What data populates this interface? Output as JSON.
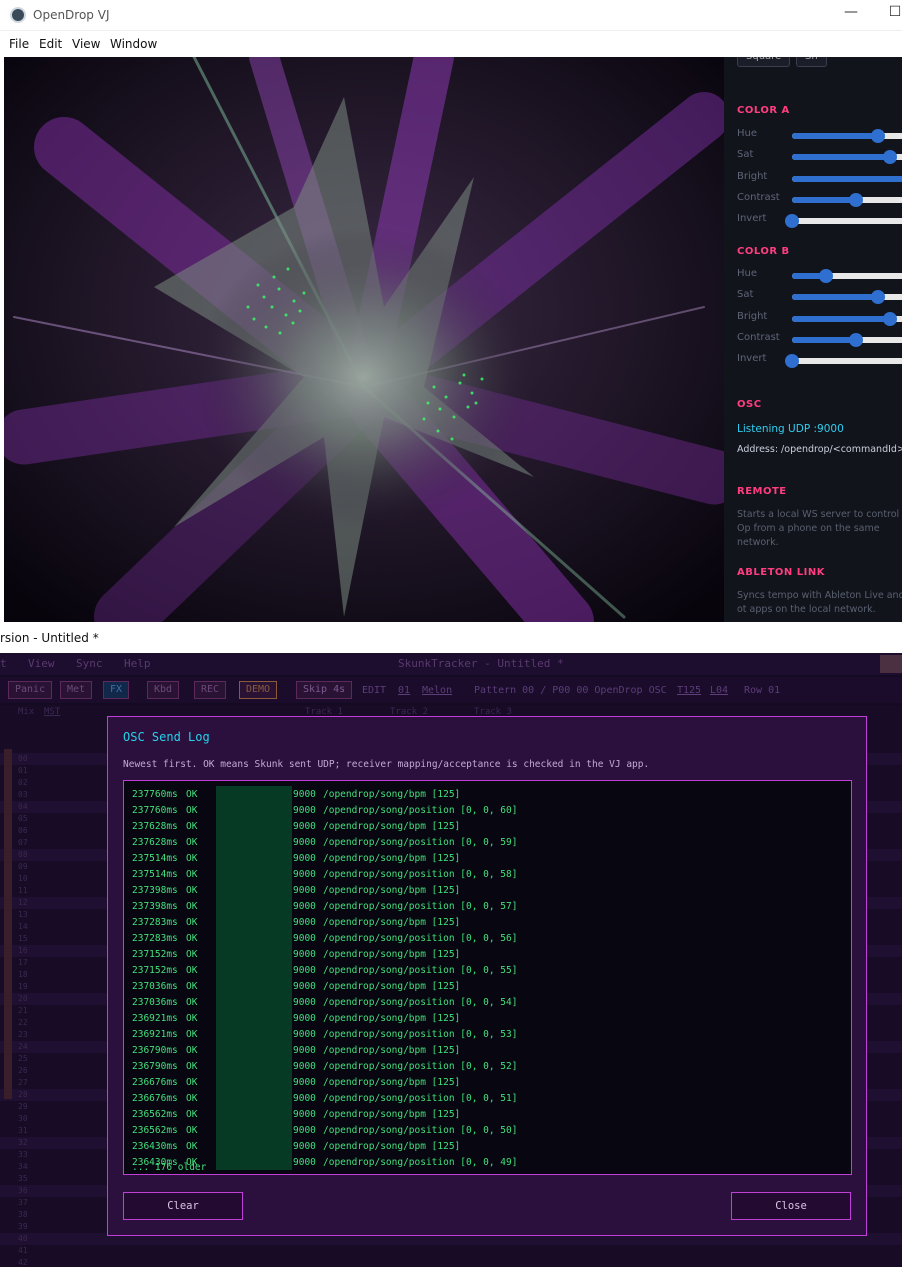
{
  "vj": {
    "title": "OpenDrop VJ",
    "menu": [
      "File",
      "Edit",
      "View",
      "Window"
    ],
    "window_controls": [
      "—",
      "☐"
    ],
    "panel": {
      "top_buttons": [
        "Square",
        "Sh"
      ],
      "color_a": {
        "title": "COLOR A",
        "sliders": [
          {
            "label": "Hue",
            "value": 0.72
          },
          {
            "label": "Sat",
            "value": 0.82
          },
          {
            "label": "Bright",
            "value": 1.0
          },
          {
            "label": "Contrast",
            "value": 0.53
          },
          {
            "label": "Invert",
            "value": 0.0
          }
        ]
      },
      "color_b": {
        "title": "COLOR B",
        "sliders": [
          {
            "label": "Hue",
            "value": 0.28
          },
          {
            "label": "Sat",
            "value": 0.72
          },
          {
            "label": "Bright",
            "value": 0.82
          },
          {
            "label": "Contrast",
            "value": 0.53
          },
          {
            "label": "Invert",
            "value": 0.0
          }
        ]
      },
      "osc": {
        "title": "OSC",
        "status": "Listening UDP :9000",
        "address": "Address: /opendrop/<commandId> f"
      },
      "remote": {
        "title": "REMOTE",
        "desc": "Starts a local WS server to control Op from a phone on the same network."
      },
      "ableton": {
        "title": "ABLETON LINK",
        "desc": "Syncs tempo with Ableton Live and ot apps on the local network."
      },
      "accent_color": "#ff3d7f",
      "slider_color": "#2f6fcf"
    }
  },
  "sk": {
    "window_title": "rsion - Untitled *",
    "menu": [
      "t",
      "View",
      "Sync",
      "Help"
    ],
    "app_title": "SkunkTracker - Untitled *",
    "toolbar": {
      "buttons": [
        "Panic",
        "Met",
        "FX",
        "Kbd",
        "REC",
        "DEMO",
        "Skip 4s"
      ],
      "edit_label": "EDIT",
      "octave": "01",
      "mode": "Melon",
      "pattern": "Pattern 00 / P00 00 OpenDrop OSC",
      "tempo": "T125",
      "loop": "L04",
      "row": "Row 01"
    },
    "mix_label": "Mix",
    "mst_label": "MST",
    "tracks": [
      "Track 1",
      "Track 2",
      "Track 3"
    ],
    "row_numbers": [
      "00",
      "01",
      "02",
      "03",
      "04",
      "05",
      "06",
      "07",
      "08",
      "09",
      "10",
      "11",
      "12",
      "13",
      "14",
      "15",
      "16",
      "17",
      "18",
      "19",
      "20",
      "21",
      "22",
      "23",
      "24",
      "25",
      "26",
      "27",
      "28",
      "29",
      "30",
      "31",
      "32",
      "33",
      "34",
      "35",
      "36",
      "37",
      "38",
      "39",
      "40",
      "41",
      "42",
      "43",
      "44",
      "45"
    ],
    "modal": {
      "title": "OSC Send Log",
      "hint": "Newest first. OK means Skunk sent UDP; receiver mapping/acceptance is checked in the VJ app.",
      "entries": [
        {
          "ms": "237760ms",
          "status": "OK",
          "port": "9000",
          "msg": "/opendrop/song/bpm [125]"
        },
        {
          "ms": "237760ms",
          "status": "OK",
          "port": "9000",
          "msg": "/opendrop/song/position [0, 0, 60]"
        },
        {
          "ms": "237628ms",
          "status": "OK",
          "port": "9000",
          "msg": "/opendrop/song/bpm [125]"
        },
        {
          "ms": "237628ms",
          "status": "OK",
          "port": "9000",
          "msg": "/opendrop/song/position [0, 0, 59]"
        },
        {
          "ms": "237514ms",
          "status": "OK",
          "port": "9000",
          "msg": "/opendrop/song/bpm [125]"
        },
        {
          "ms": "237514ms",
          "status": "OK",
          "port": "9000",
          "msg": "/opendrop/song/position [0, 0, 58]"
        },
        {
          "ms": "237398ms",
          "status": "OK",
          "port": "9000",
          "msg": "/opendrop/song/bpm [125]"
        },
        {
          "ms": "237398ms",
          "status": "OK",
          "port": "9000",
          "msg": "/opendrop/song/position [0, 0, 57]"
        },
        {
          "ms": "237283ms",
          "status": "OK",
          "port": "9000",
          "msg": "/opendrop/song/bpm [125]"
        },
        {
          "ms": "237283ms",
          "status": "OK",
          "port": "9000",
          "msg": "/opendrop/song/position [0, 0, 56]"
        },
        {
          "ms": "237152ms",
          "status": "OK",
          "port": "9000",
          "msg": "/opendrop/song/bpm [125]"
        },
        {
          "ms": "237152ms",
          "status": "OK",
          "port": "9000",
          "msg": "/opendrop/song/position [0, 0, 55]"
        },
        {
          "ms": "237036ms",
          "status": "OK",
          "port": "9000",
          "msg": "/opendrop/song/bpm [125]"
        },
        {
          "ms": "237036ms",
          "status": "OK",
          "port": "9000",
          "msg": "/opendrop/song/position [0, 0, 54]"
        },
        {
          "ms": "236921ms",
          "status": "OK",
          "port": "9000",
          "msg": "/opendrop/song/bpm [125]"
        },
        {
          "ms": "236921ms",
          "status": "OK",
          "port": "9000",
          "msg": "/opendrop/song/position [0, 0, 53]"
        },
        {
          "ms": "236790ms",
          "status": "OK",
          "port": "9000",
          "msg": "/opendrop/song/bpm [125]"
        },
        {
          "ms": "236790ms",
          "status": "OK",
          "port": "9000",
          "msg": "/opendrop/song/position [0, 0, 52]"
        },
        {
          "ms": "236676ms",
          "status": "OK",
          "port": "9000",
          "msg": "/opendrop/song/bpm [125]"
        },
        {
          "ms": "236676ms",
          "status": "OK",
          "port": "9000",
          "msg": "/opendrop/song/position [0, 0, 51]"
        },
        {
          "ms": "236562ms",
          "status": "OK",
          "port": "9000",
          "msg": "/opendrop/song/bpm [125]"
        },
        {
          "ms": "236562ms",
          "status": "OK",
          "port": "9000",
          "msg": "/opendrop/song/position [0, 0, 50]"
        },
        {
          "ms": "236430ms",
          "status": "OK",
          "port": "9000",
          "msg": "/opendrop/song/bpm [125]"
        },
        {
          "ms": "236430ms",
          "status": "OK",
          "port": "9000",
          "msg": "/opendrop/song/position [0, 0, 49]"
        }
      ],
      "older": "... 176 older",
      "clear_label": "Clear",
      "close_label": "Close"
    }
  }
}
